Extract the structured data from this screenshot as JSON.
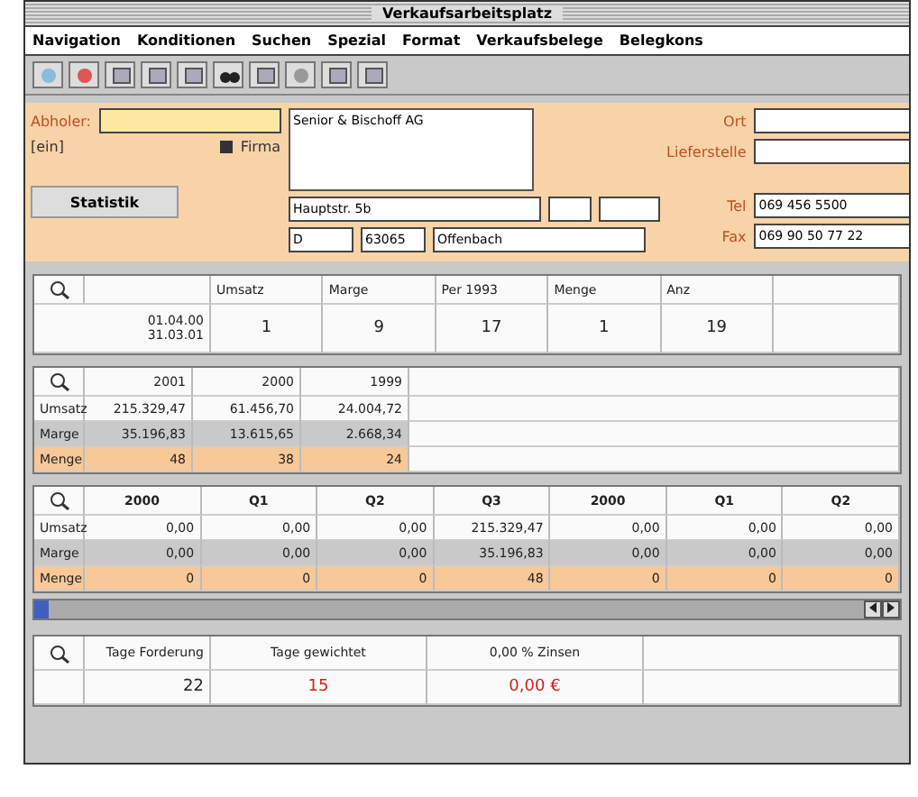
{
  "window": {
    "title": "Verkaufsarbeitsplatz"
  },
  "menu": [
    "Navigation",
    "Konditionen",
    "Suchen",
    "Spezial",
    "Format",
    "Verkaufsbelege",
    "Belegkons"
  ],
  "customer": {
    "pickup_label": "Abholer:",
    "bracket": "[ein]",
    "company": {
      "label": "Firma",
      "checked": true
    },
    "name": "Senior & Bischoff AG",
    "street": "Hauptstr. 5b",
    "country": "D",
    "zip": "63065",
    "city": "Offenbach",
    "right": [
      {
        "label": "Ort"
      },
      {
        "label": "Lieferstelle"
      }
    ],
    "phone": {
      "label": "Tel",
      "value": "069 456 5500"
    },
    "fax": {
      "label": "Fax",
      "value": "069 90 50 77 22"
    },
    "stats_button": "Statistik"
  },
  "summary": {
    "columns": [
      "Umsatz",
      "Marge",
      "Per 1993",
      "Menge",
      "Anz"
    ],
    "period": [
      "01.04.00",
      "31.03.01"
    ],
    "values": [
      "1",
      "9",
      "17",
      "1",
      "19"
    ]
  },
  "years": {
    "columns": [
      "2001",
      "2000",
      "1999"
    ],
    "rows": [
      {
        "label": "Umsatz",
        "kind": "plain",
        "values": [
          "215.329,47",
          "61.456,70",
          "24.004,72"
        ]
      },
      {
        "label": "Marge",
        "kind": "grey",
        "values": [
          "35.196,83",
          "13.615,65",
          "2.668,34"
        ]
      },
      {
        "label": "Menge",
        "kind": "orange",
        "values": [
          "48",
          "38",
          "24"
        ]
      }
    ]
  },
  "quarters": {
    "columns": [
      "2000",
      "Q1",
      "Q2",
      "Q3",
      "2000",
      "Q1",
      "Q2"
    ],
    "rows": [
      {
        "label": "Umsatz",
        "kind": "plain",
        "values": [
          "0,00",
          "0,00",
          "0,00",
          "215.329,47",
          "0,00",
          "0,00",
          "0,00"
        ]
      },
      {
        "label": "Marge",
        "kind": "grey",
        "values": [
          "0,00",
          "0,00",
          "0,00",
          "35.196,83",
          "0,00",
          "0,00",
          "0,00"
        ]
      },
      {
        "label": "Menge",
        "kind": "orange",
        "values": [
          "0",
          "0",
          "0",
          "48",
          "0",
          "0",
          "0"
        ]
      }
    ]
  },
  "payment": {
    "columns": [
      "Tage Forderung",
      "Tage gewichtet",
      "0,00 % Zinsen"
    ],
    "values": [
      {
        "text": "22",
        "alert": false
      },
      {
        "text": "15",
        "alert": true
      },
      {
        "text": "0,00 €",
        "alert": true
      }
    ]
  }
}
